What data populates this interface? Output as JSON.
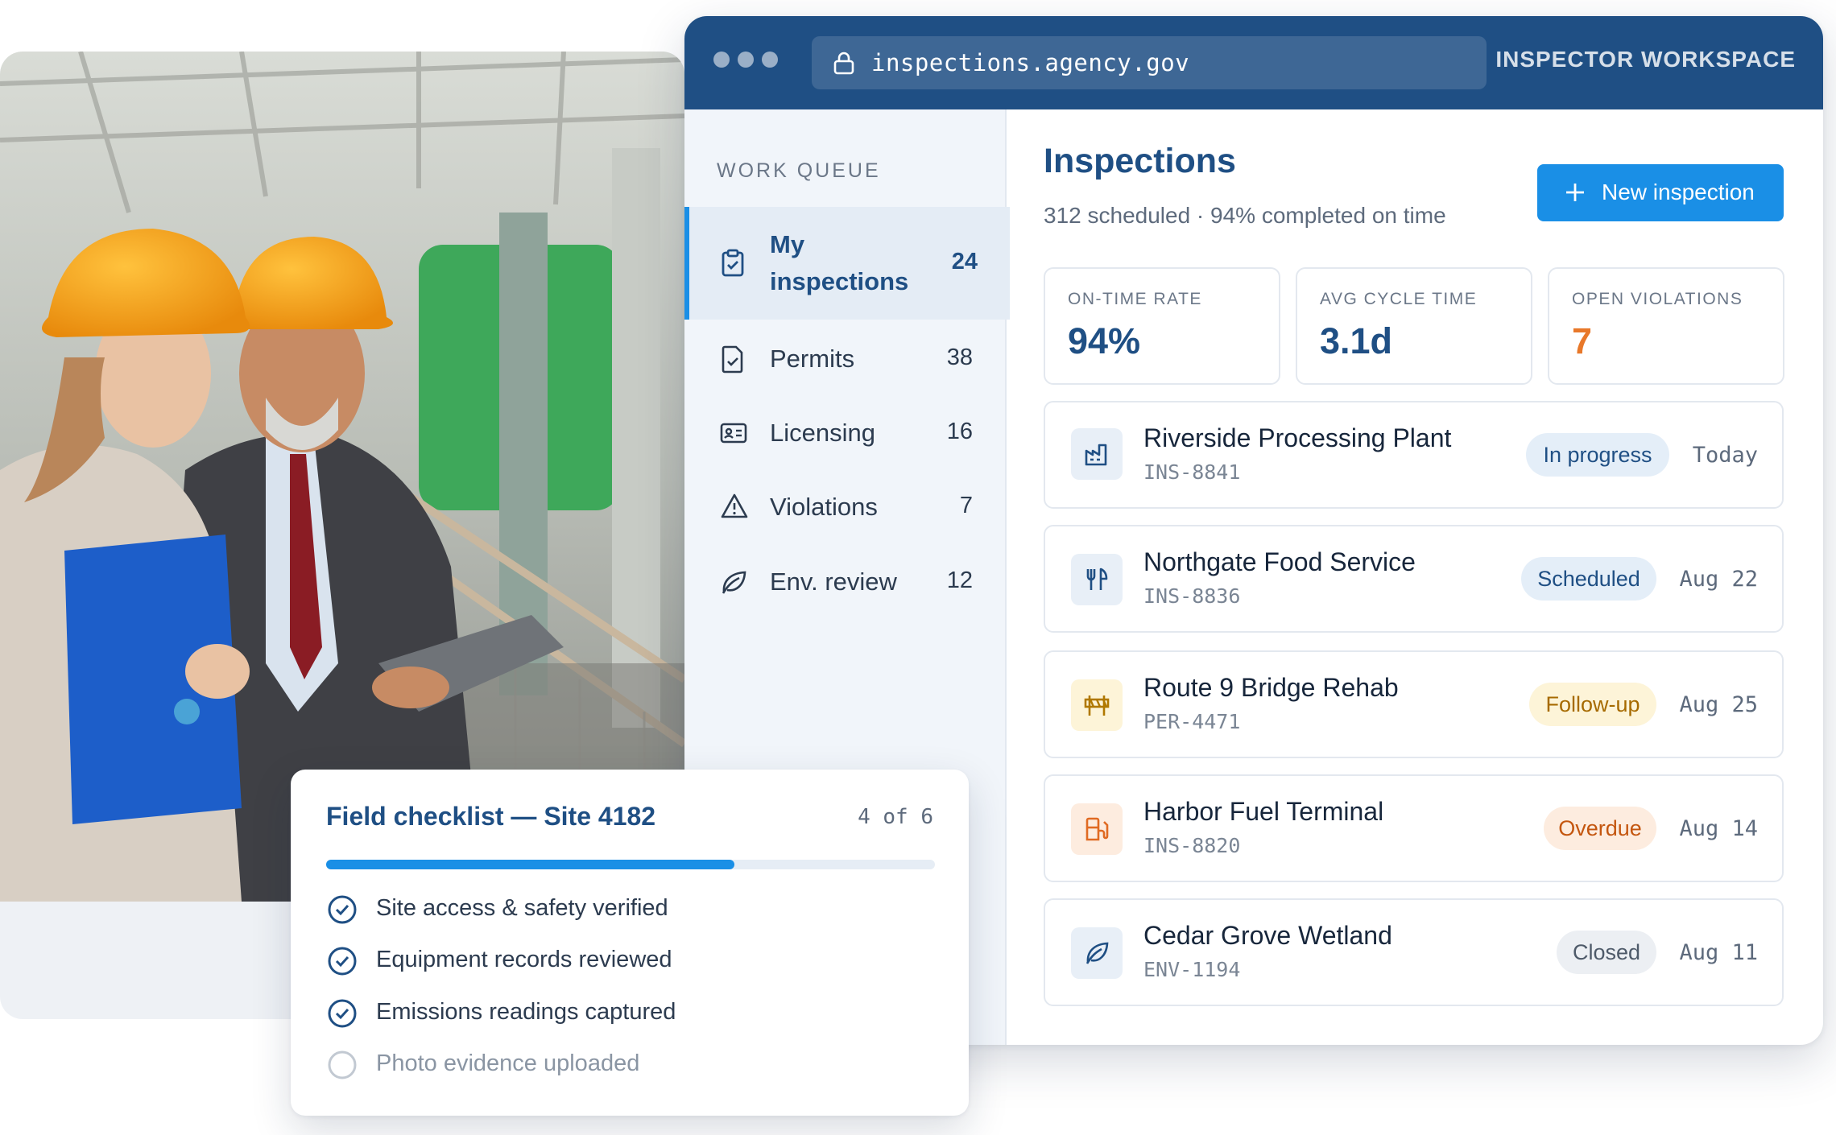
{
  "browser": {
    "url": "inspections.agency.gov",
    "workspace_label": "INSPECTOR WORKSPACE"
  },
  "sidebar": {
    "heading": "WORK QUEUE",
    "items": [
      {
        "label_line1": "My",
        "label_line2": "inspections",
        "count": "24",
        "icon": "clipboard-check-icon",
        "active": true
      },
      {
        "label": "Permits",
        "count": "38",
        "icon": "document-check-icon"
      },
      {
        "label": "Licensing",
        "count": "16",
        "icon": "id-card-icon"
      },
      {
        "label": "Violations",
        "count": "7",
        "icon": "warning-triangle-icon"
      },
      {
        "label": "Env. review",
        "count": "12",
        "icon": "leaf-icon"
      }
    ]
  },
  "main": {
    "title": "Inspections",
    "subtitle": "312 scheduled · 94% completed on time",
    "new_button": "New inspection",
    "stats": [
      {
        "label": "ON-TIME RATE",
        "value": "94%",
        "color": "#1f4f84"
      },
      {
        "label": "AVG CYCLE TIME",
        "value": "3.1d",
        "color": "#1f4f84"
      },
      {
        "label": "OPEN VIOLATIONS",
        "value": "7",
        "color": "#e8782a"
      }
    ],
    "inspections": [
      {
        "name": "Riverside Processing Plant",
        "code": "INS-8841",
        "status": "In progress",
        "date": "Today",
        "icon": "factory-icon",
        "status_bg": "#e4eef8",
        "status_fg": "#1f4f84",
        "icon_bg": "#e8eff7",
        "icon_fg": "#1f4f84"
      },
      {
        "name": "Northgate Food Service",
        "code": "INS-8836",
        "status": "Scheduled",
        "date": "Aug 22",
        "icon": "utensils-icon",
        "status_bg": "#e4eef8",
        "status_fg": "#1f4f84",
        "icon_bg": "#e8eff7",
        "icon_fg": "#1f4f84"
      },
      {
        "name": "Route 9 Bridge Rehab",
        "code": "PER-4471",
        "status": "Follow-up",
        "date": "Aug 25",
        "icon": "roadblock-icon",
        "status_bg": "#fdf4d8",
        "status_fg": "#a66a00",
        "icon_bg": "#fdf4d8",
        "icon_fg": "#b07800"
      },
      {
        "name": "Harbor Fuel Terminal",
        "code": "INS-8820",
        "status": "Overdue",
        "date": "Aug 14",
        "icon": "fuel-pump-icon",
        "status_bg": "#fdecdf",
        "status_fg": "#c4560f",
        "icon_bg": "#fdecdf",
        "icon_fg": "#e06a22"
      },
      {
        "name": "Cedar Grove Wetland",
        "code": "ENV-1194",
        "status": "Closed",
        "date": "Aug 11",
        "icon": "leaf-icon",
        "status_bg": "#eceff3",
        "status_fg": "#4e5a69",
        "icon_bg": "#e8eff7",
        "icon_fg": "#1f4f84"
      }
    ]
  },
  "checklist": {
    "title": "Field checklist — Site 4182",
    "progress_text": "4 of 6",
    "progress_fraction": 0.67,
    "items": [
      {
        "text": "Site access & safety verified",
        "done": true
      },
      {
        "text": "Equipment records reviewed",
        "done": true
      },
      {
        "text": "Emissions readings captured",
        "done": true
      },
      {
        "text": "Photo evidence uploaded",
        "done": false
      }
    ]
  },
  "colors": {
    "brand_navy": "#1f4f84",
    "accent_blue": "#1a8fe6",
    "warning_orange": "#e8782a"
  }
}
